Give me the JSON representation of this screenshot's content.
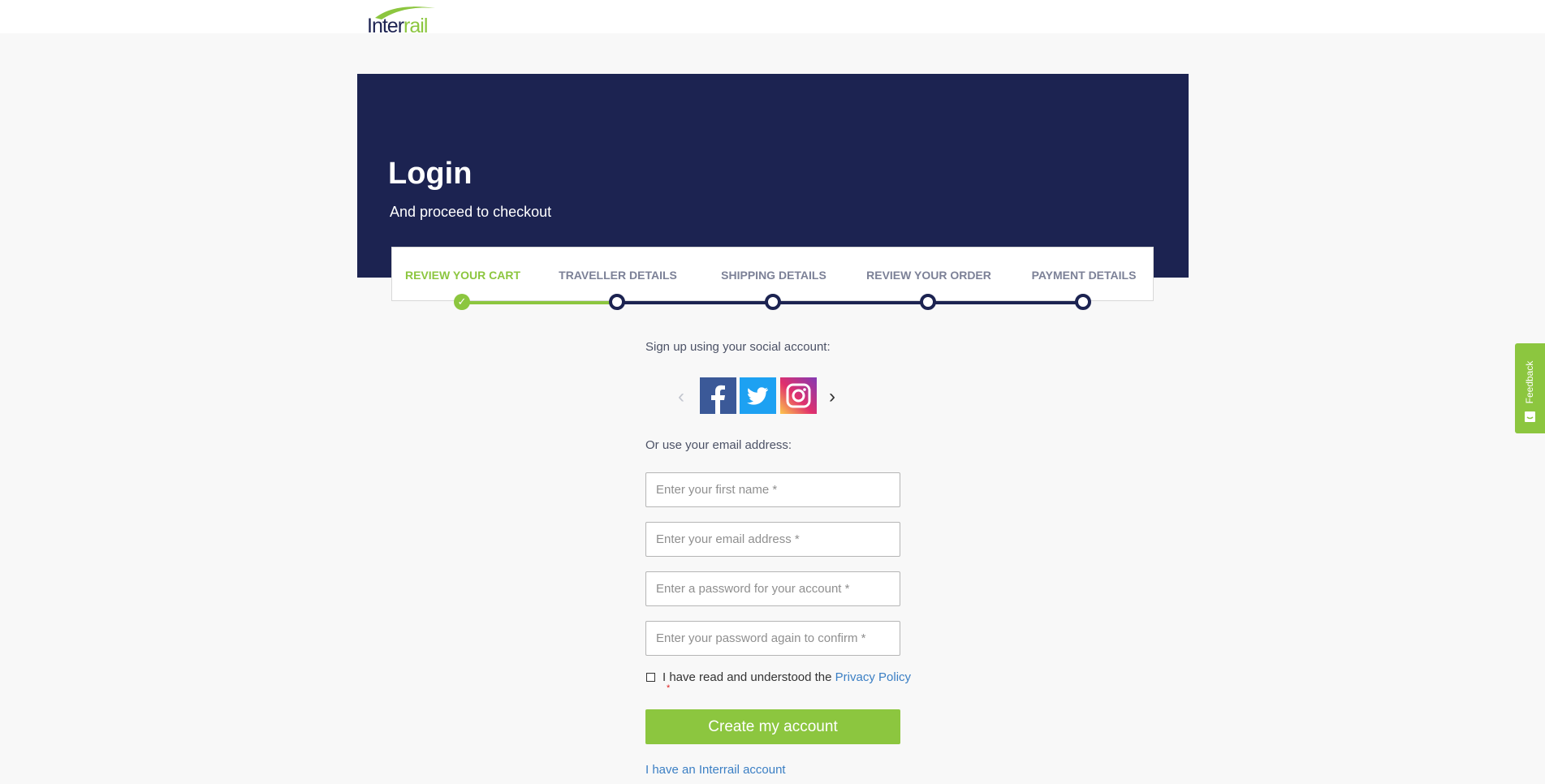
{
  "brand": {
    "logo_part1": "Inter",
    "logo_part2": "rail",
    "primary_color": "#1c2351",
    "accent_color": "#8cc63f",
    "link_color": "#3b7fc4"
  },
  "hero": {
    "title": "Login",
    "subtitle": "And proceed to checkout"
  },
  "steps": [
    {
      "label": "REVIEW YOUR CART",
      "status": "completed"
    },
    {
      "label": "TRAVELLER DETAILS",
      "status": "current"
    },
    {
      "label": "SHIPPING DETAILS",
      "status": "upcoming"
    },
    {
      "label": "REVIEW YOUR ORDER",
      "status": "upcoming"
    },
    {
      "label": "PAYMENT DETAILS",
      "status": "upcoming"
    }
  ],
  "social": {
    "heading": "Sign up using your social account:",
    "prev_icon": "chevron-left-icon",
    "next_icon": "chevron-right-icon",
    "providers": [
      {
        "name": "Facebook",
        "icon": "facebook-icon",
        "color": "#3b5998"
      },
      {
        "name": "Twitter",
        "icon": "twitter-icon",
        "color": "#1da1f2"
      },
      {
        "name": "Instagram",
        "icon": "instagram-icon",
        "color": "#e1306c"
      }
    ]
  },
  "form": {
    "email_heading": "Or use your email address:",
    "first_name_placeholder": "Enter your first name *",
    "email_placeholder": "Enter your email address *",
    "password_placeholder": "Enter a password for your account *",
    "confirm_placeholder": "Enter your password again to confirm *",
    "consent_text": "I have read and understood the ",
    "privacy_link": "Privacy Policy",
    "required_mark": "*",
    "submit_label": "Create my account",
    "login_link": "I have an Interrail account"
  },
  "feedback": {
    "label": "Feedback",
    "icon": "feedback-icon"
  }
}
